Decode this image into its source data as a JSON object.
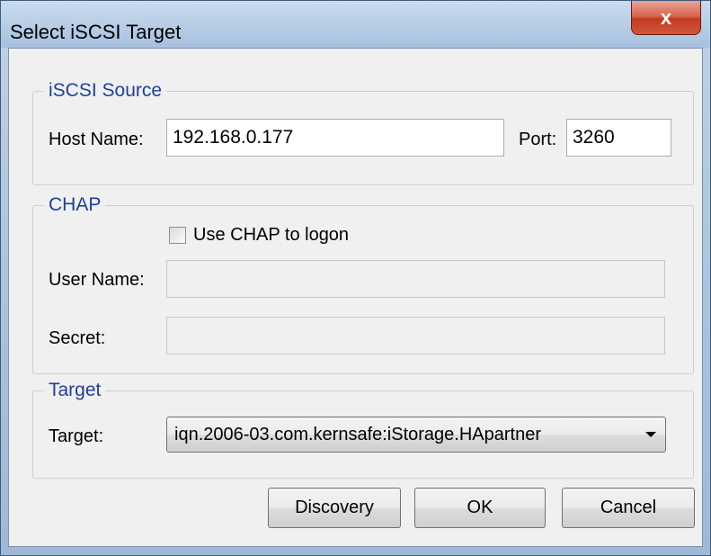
{
  "window": {
    "title": "Select iSCSI Target",
    "close_label": "x"
  },
  "iscsi_source": {
    "legend": "iSCSI Source",
    "host_label": "Host Name:",
    "host_value": "192.168.0.177",
    "port_label": "Port:",
    "port_value": "3260"
  },
  "chap": {
    "legend": "CHAP",
    "checkbox_label": "Use CHAP to logon",
    "checkbox_checked": false,
    "user_label": "User Name:",
    "user_value": "",
    "secret_label": "Secret:",
    "secret_value": ""
  },
  "target": {
    "legend": "Target",
    "target_label": "Target:",
    "selected": "iqn.2006-03.com.kernsafe:iStorage.HApartner"
  },
  "buttons": {
    "discovery": "Discovery",
    "ok": "OK",
    "cancel": "Cancel"
  }
}
